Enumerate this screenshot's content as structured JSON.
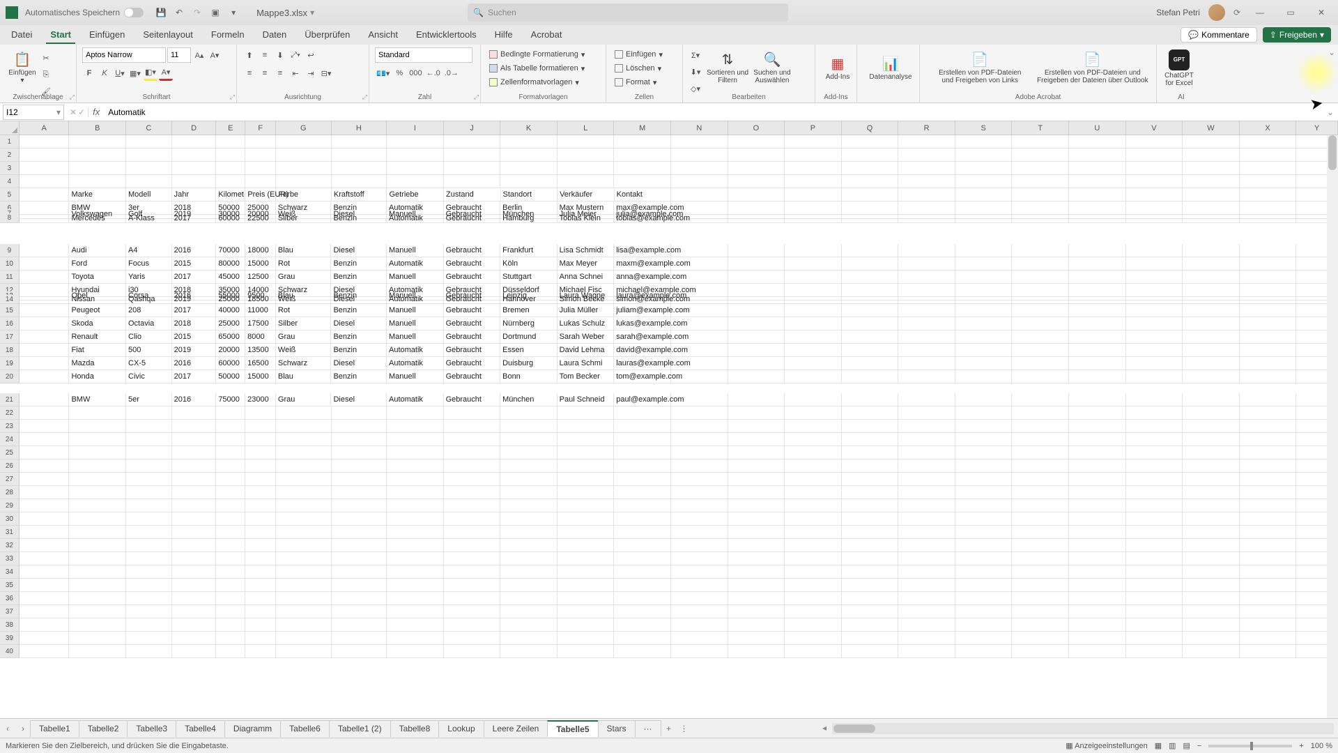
{
  "titlebar": {
    "autosave": "Automatisches Speichern",
    "filename": "Mappe3.xlsx",
    "search_placeholder": "Suchen",
    "username": "Stefan Petri"
  },
  "tabs": {
    "items": [
      "Datei",
      "Start",
      "Einfügen",
      "Seitenlayout",
      "Formeln",
      "Daten",
      "Überprüfen",
      "Ansicht",
      "Entwicklertools",
      "Hilfe",
      "Acrobat"
    ],
    "active": 1,
    "kommentare": "Kommentare",
    "freigeben": "Freigeben"
  },
  "ribbon": {
    "paste": "Einfügen",
    "clipboard_label": "Zwischenablage",
    "font_name": "Aptos Narrow",
    "font_size": "11",
    "font_label": "Schriftart",
    "align_label": "Ausrichtung",
    "number_format": "Standard",
    "number_label": "Zahl",
    "cond_fmt": "Bedingte Formatierung",
    "as_table": "Als Tabelle formatieren",
    "cell_styles": "Zellenformatvorlagen",
    "styles_label": "Formatvorlagen",
    "insert": "Einfügen",
    "delete": "Löschen",
    "format": "Format",
    "cells_label": "Zellen",
    "sort_filter": "Sortieren und Filtern",
    "find_select": "Suchen und Auswählen",
    "edit_label": "Bearbeiten",
    "addins": "Add-Ins",
    "addins_label": "Add-Ins",
    "datenanalyse": "Datenanalyse",
    "pdf1a": "Erstellen von PDF-Dateien",
    "pdf1b": "und Freigeben von Links",
    "pdf2a": "Erstellen von PDF-Dateien und",
    "pdf2b": "Freigeben der Dateien über Outlook",
    "acrobat_label": "Adobe Acrobat",
    "chatgpt1": "ChatGPT",
    "chatgpt2": "for Excel",
    "ai_label": "AI"
  },
  "formula": {
    "cell_ref": "I12",
    "value": "Automatik"
  },
  "columns": [
    "A",
    "B",
    "C",
    "D",
    "E",
    "F",
    "G",
    "H",
    "I",
    "J",
    "K",
    "L",
    "M",
    "N",
    "O",
    "P",
    "Q",
    "R",
    "S",
    "T",
    "U",
    "V",
    "W",
    "X",
    "Y"
  ],
  "row_numbers_top": [
    "1",
    "2",
    "3",
    "4",
    "5",
    "6",
    "7",
    "8"
  ],
  "row_numbers_mid": [
    "9",
    "10",
    "11",
    "12",
    "13",
    "14",
    "15",
    "16",
    "17",
    "18",
    "19",
    "20"
  ],
  "row_numbers_bot": [
    "21",
    "22",
    "23",
    "24",
    "25",
    "26",
    "27",
    "28",
    "29",
    "30",
    "31",
    "32",
    "33",
    "34",
    "35",
    "36",
    "37",
    "38",
    "39",
    "40"
  ],
  "header_row": [
    "",
    "Marke",
    "Modell",
    "Jahr",
    "Kilomet",
    "Preis (EUR)",
    "Farbe",
    "Kraftstoff",
    "Getriebe",
    "Zustand",
    "Standort",
    "Verkäufer",
    "Kontakt"
  ],
  "data_block1": [
    [
      "",
      "BMW",
      "3er",
      "2018",
      "50000",
      "25000",
      "Schwarz",
      "Benzin",
      "Automatik",
      "Gebraucht",
      "Berlin",
      "Max Mustern",
      "max@example.com"
    ],
    [
      "",
      "Volkswagen",
      "Golf",
      "2019",
      "30000",
      "20000",
      "Weiß",
      "Diesel",
      "Manuell",
      "Gebraucht",
      "München",
      "Julia Meier",
      "julia@example.com"
    ],
    [
      "",
      "Mercedes",
      "A-Klass",
      "2017",
      "60000",
      "22500",
      "Silber",
      "Benzin",
      "Automatik",
      "Gebraucht",
      "Hamburg",
      "Tobias Klein",
      "tobias@example.com"
    ]
  ],
  "data_block2": [
    [
      "",
      "Audi",
      "A4",
      "2016",
      "70000",
      "18000",
      "Blau",
      "Diesel",
      "Manuell",
      "Gebraucht",
      "Frankfurt",
      "Lisa Schmidt",
      "lisa@example.com"
    ],
    [
      "",
      "Ford",
      "Focus",
      "2015",
      "80000",
      "15000",
      "Rot",
      "Benzin",
      "Automatik",
      "Gebraucht",
      "Köln",
      "Max Meyer",
      "maxm@example.com"
    ],
    [
      "",
      "Toyota",
      "Yaris",
      "2017",
      "45000",
      "12500",
      "Grau",
      "Benzin",
      "Manuell",
      "Gebraucht",
      "Stuttgart",
      "Anna Schnei",
      "anna@example.com"
    ],
    [
      "",
      "Hyundai",
      "i30",
      "2018",
      "35000",
      "14000",
      "Schwarz",
      "Diesel",
      "Automatik",
      "Gebraucht",
      "Düsseldorf",
      "Michael Fisc",
      "michael@example.com"
    ],
    [
      "",
      "Opel",
      "Corsa",
      "2016",
      "55000",
      "9500",
      "Blau",
      "Benzin",
      "Manuell",
      "Gebraucht",
      "Leipzig",
      "Laura Wagne",
      "laura@example.com"
    ],
    [
      "",
      "Nissan",
      "Qashqa",
      "2019",
      "25000",
      "18500",
      "Weiß",
      "Diesel",
      "Automatik",
      "Gebraucht",
      "Hannover",
      "Simon Becke",
      "simon@example.com"
    ],
    [
      "",
      "Peugeot",
      "208",
      "2017",
      "40000",
      "11000",
      "Rot",
      "Benzin",
      "Manuell",
      "Gebraucht",
      "Bremen",
      "Julia Müller",
      "juliam@example.com"
    ],
    [
      "",
      "Skoda",
      "Octavia",
      "2018",
      "25000",
      "17500",
      "Silber",
      "Diesel",
      "Manuell",
      "Gebraucht",
      "Nürnberg",
      "Lukas Schulz",
      "lukas@example.com"
    ],
    [
      "",
      "Renault",
      "Clio",
      "2015",
      "65000",
      "8000",
      "Grau",
      "Benzin",
      "Manuell",
      "Gebraucht",
      "Dortmund",
      "Sarah Weber",
      "sarah@example.com"
    ],
    [
      "",
      "Fiat",
      "500",
      "2019",
      "20000",
      "13500",
      "Weiß",
      "Benzin",
      "Automatik",
      "Gebraucht",
      "Essen",
      "David Lehma",
      "david@example.com"
    ],
    [
      "",
      "Mazda",
      "CX-5",
      "2016",
      "60000",
      "16500",
      "Schwarz",
      "Diesel",
      "Automatik",
      "Gebraucht",
      "Duisburg",
      "Laura Schmi",
      "lauras@example.com"
    ],
    [
      "",
      "Honda",
      "Civic",
      "2017",
      "50000",
      "15000",
      "Blau",
      "Benzin",
      "Manuell",
      "Gebraucht",
      "Bonn",
      "Tom Becker",
      "tom@example.com"
    ]
  ],
  "data_block3": [
    [
      "",
      "BMW",
      "5er",
      "2016",
      "75000",
      "23000",
      "Grau",
      "Diesel",
      "Automatik",
      "Gebraucht",
      "München",
      "Paul Schneid",
      "paul@example.com"
    ]
  ],
  "sheets": {
    "list": [
      "Tabelle1",
      "Tabelle2",
      "Tabelle3",
      "Tabelle4",
      "Diagramm",
      "Tabelle6",
      "Tabelle1 (2)",
      "Tabelle8",
      "Lookup",
      "Leere Zeilen",
      "Tabelle5",
      "Stars"
    ],
    "active": 10,
    "more": "···",
    "add": "+"
  },
  "status": {
    "msg": "Markieren Sie den Zielbereich, und drücken Sie die Eingabetaste.",
    "anzeige": "Anzeigeeinstellungen",
    "zoom": "100 %"
  }
}
